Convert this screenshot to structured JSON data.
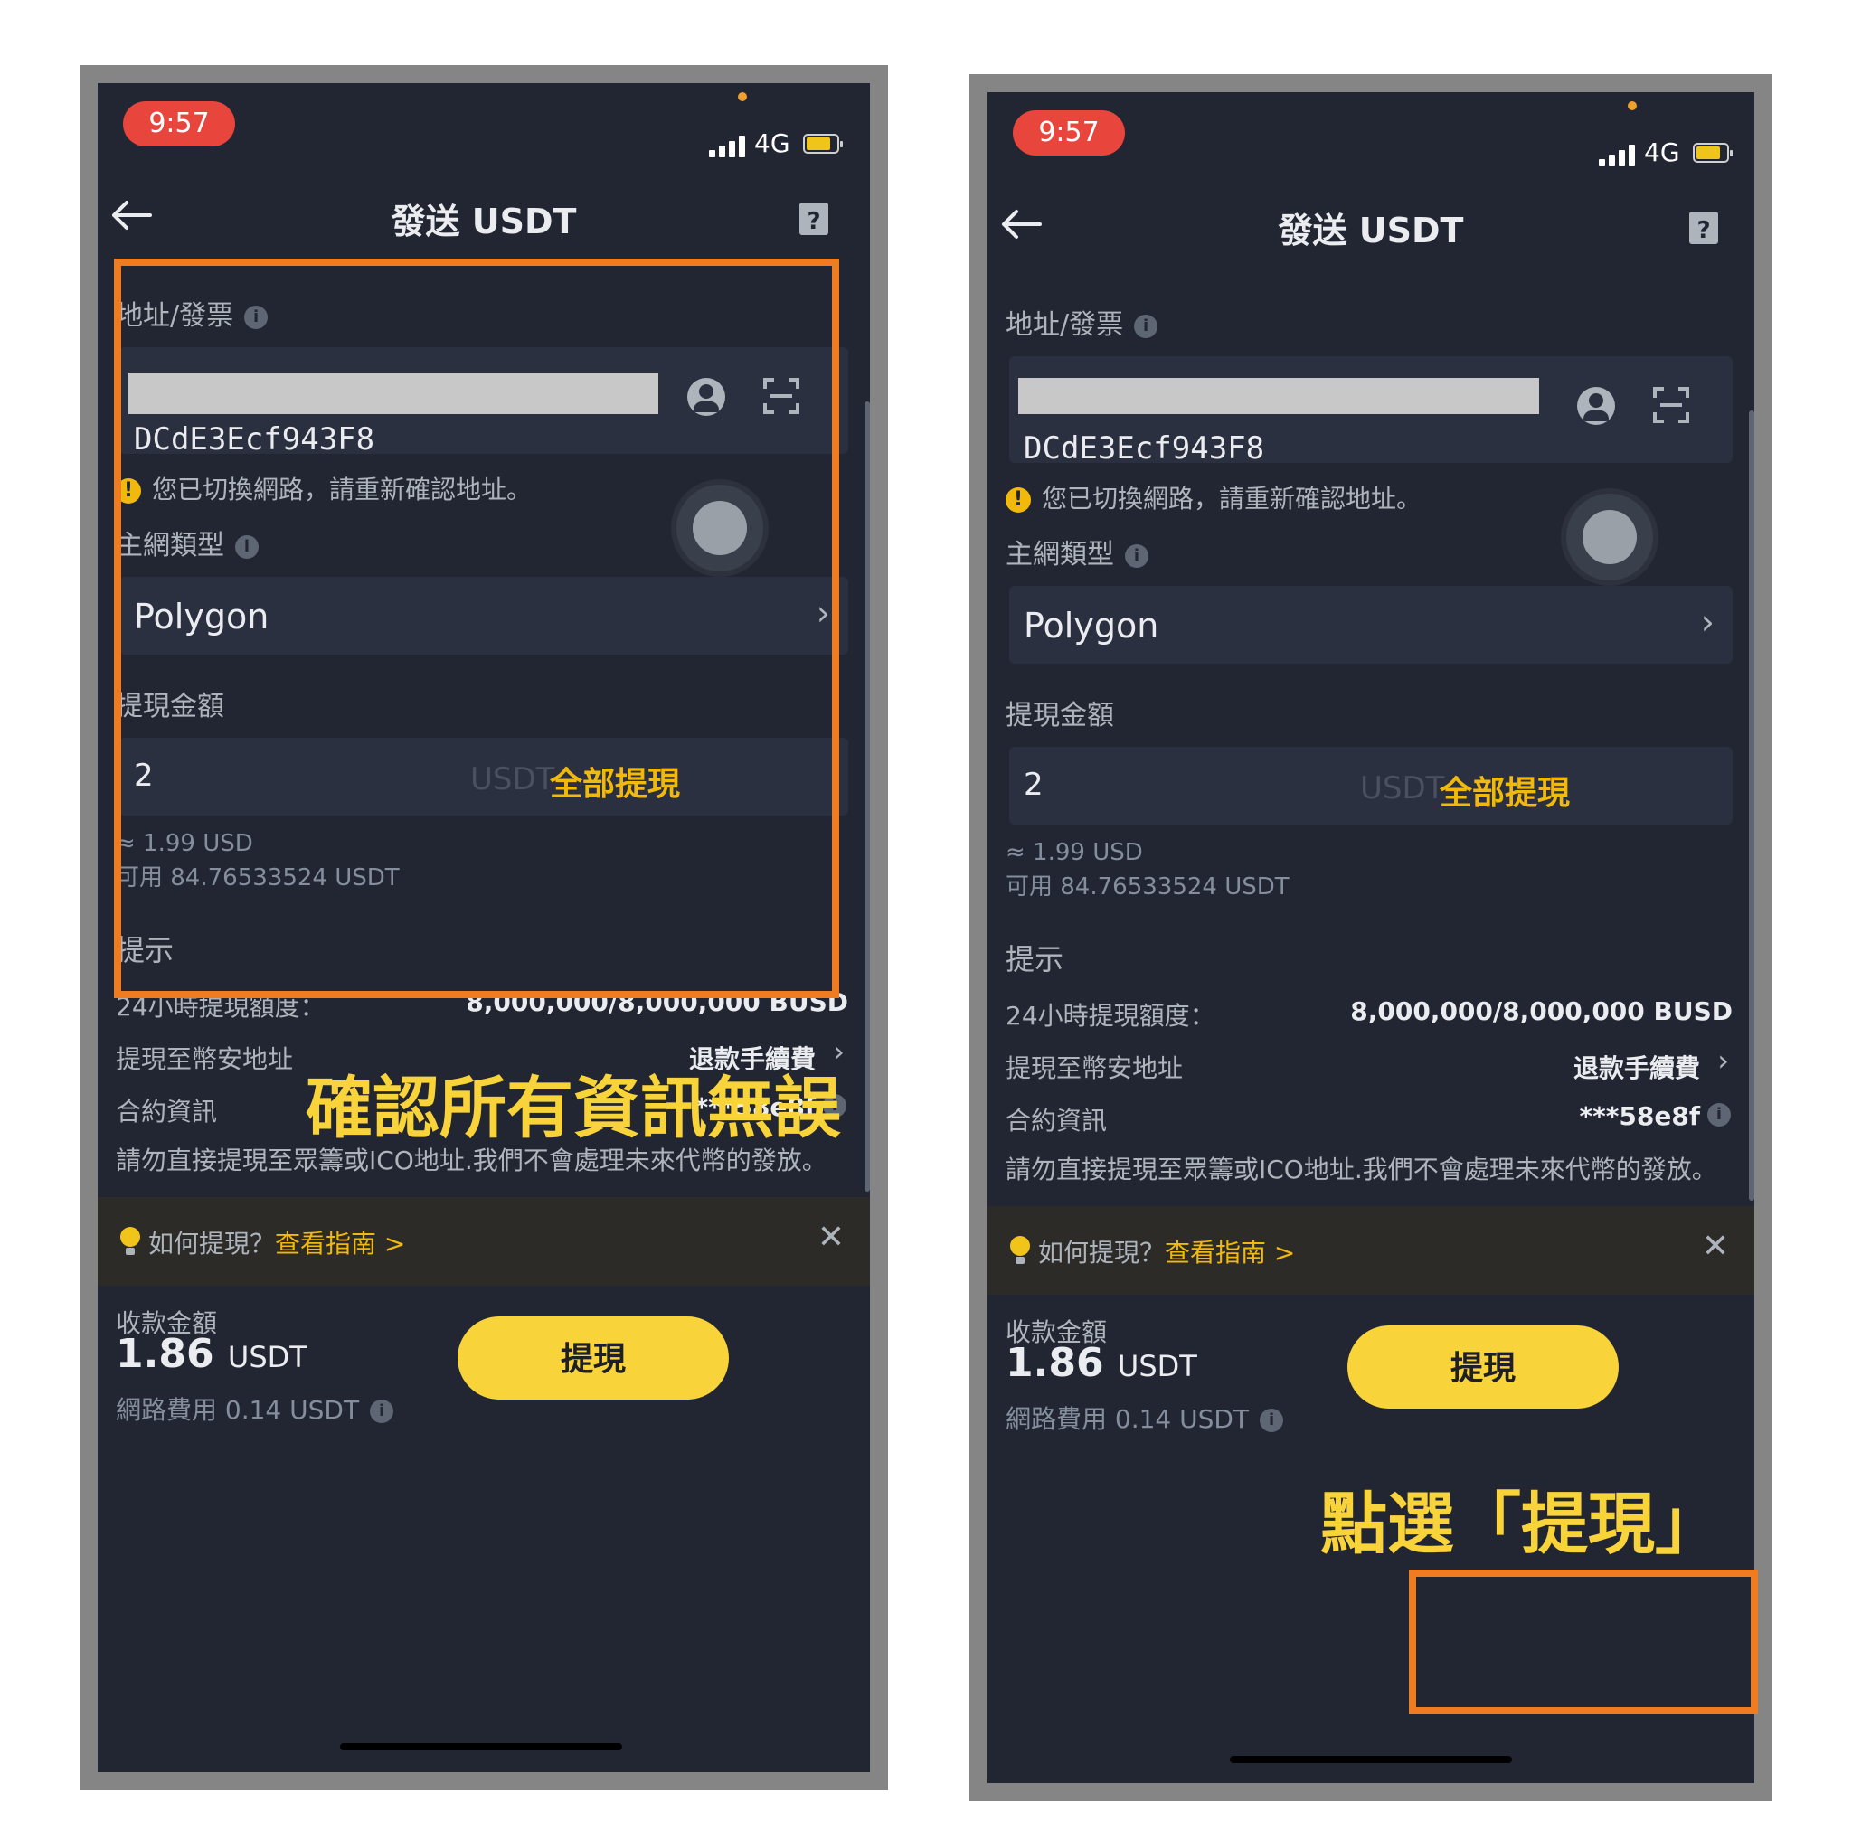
{
  "screens": [
    {
      "status": {
        "time": "9:57",
        "network": "4G"
      },
      "header": {
        "title": "發送 USDT"
      },
      "address": {
        "label": "地址/發票",
        "value": "DCdE3Ecf943F8",
        "warning": "您已切換網路，請重新確認地址。"
      },
      "network": {
        "label": "主網類型",
        "value": "Polygon"
      },
      "amount": {
        "label": "提現金額",
        "value": "2",
        "unit": "USDT",
        "max_label": "全部提現",
        "approx": "≈ 1.99 USD",
        "available": "可用  84.76533524 USDT"
      },
      "tips": {
        "title": "提示",
        "rows": [
          {
            "label": "24小時提現額度：",
            "value": "8,000,000/8,000,000 BUSD"
          },
          {
            "label": "提現至幣安地址",
            "value": "退款手續費"
          },
          {
            "label": "合約資訊",
            "value": "***58e8f"
          }
        ],
        "notice": "請勿直接提現至眾籌或ICO地址.我們不會處理未來代幣的發放。"
      },
      "guide": {
        "text": "如何提現？",
        "link": "查看指南 >"
      },
      "receive": {
        "label": "收款金額",
        "amount": "1.86",
        "unit": "USDT",
        "fee": "網路費用 0.14 USDT"
      },
      "button": {
        "label": "提現"
      }
    },
    {
      "status": {
        "time": "9:57",
        "network": "4G"
      },
      "header": {
        "title": "發送 USDT"
      },
      "address": {
        "label": "地址/發票",
        "value": "DCdE3Ecf943F8",
        "warning": "您已切換網路，請重新確認地址。"
      },
      "network": {
        "label": "主網類型",
        "value": "Polygon"
      },
      "amount": {
        "label": "提現金額",
        "value": "2",
        "unit": "USDT",
        "max_label": "全部提現",
        "approx": "≈ 1.99 USD",
        "available": "可用  84.76533524 USDT"
      },
      "tips": {
        "title": "提示",
        "rows": [
          {
            "label": "24小時提現額度：",
            "value": "8,000,000/8,000,000 BUSD"
          },
          {
            "label": "提現至幣安地址",
            "value": "退款手續費"
          },
          {
            "label": "合約資訊",
            "value": "***58e8f"
          }
        ],
        "notice": "請勿直接提現至眾籌或ICO地址.我們不會處理未來代幣的發放。"
      },
      "guide": {
        "text": "如何提現？",
        "link": "查看指南 >"
      },
      "receive": {
        "label": "收款金額",
        "amount": "1.86",
        "unit": "USDT",
        "fee": "網路費用 0.14 USDT"
      },
      "button": {
        "label": "提現"
      }
    }
  ],
  "annotations": {
    "left_caption": "確認所有資訊無誤",
    "right_caption": "點選「提現」",
    "highlight_color": "#f07c22",
    "caption_color": "#f8d33a"
  },
  "theme": {
    "background": "#222632",
    "accent": "#f0b90b",
    "button": "#f8d33a"
  }
}
